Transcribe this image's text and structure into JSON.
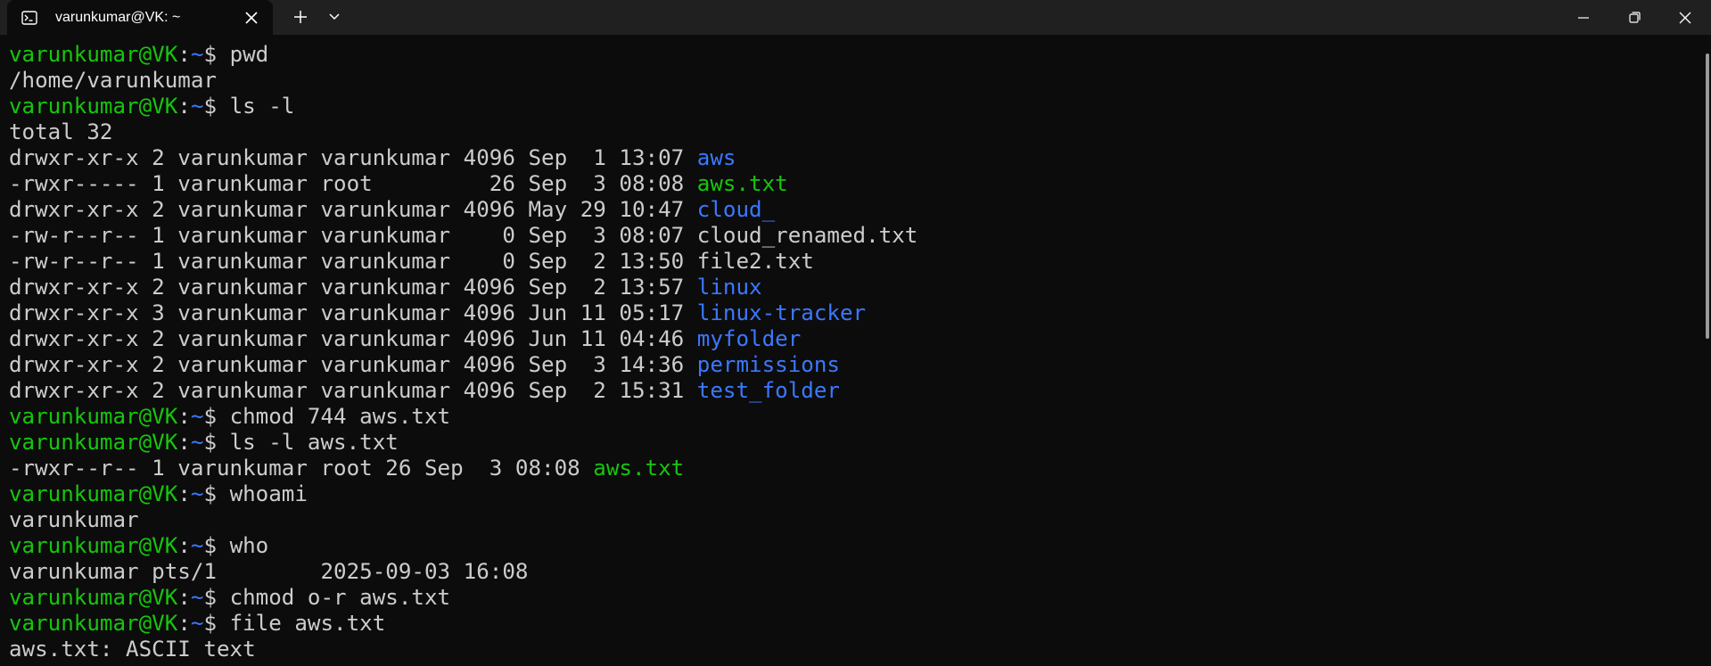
{
  "window": {
    "tab_title": "varunkumar@VK: ~",
    "icons": {
      "tab": "terminal-icon",
      "close_tab": "close-icon",
      "new_tab": "plus-icon",
      "dropdown": "chevron-down-icon",
      "minimize": "minimize-icon",
      "restore": "restore-icon",
      "close_window": "close-icon"
    }
  },
  "colors": {
    "background": "#0c0c0c",
    "titlebar": "#202020",
    "prompt_user": "#16c60c",
    "prompt_path": "#3b78ff",
    "directory": "#3b78ff",
    "executable": "#16c60c",
    "text": "#cccccc"
  },
  "terminal": {
    "prompt": {
      "user": "varunkumar@VK",
      "sep": ":",
      "path": "~",
      "symbol": "$ "
    },
    "lines": [
      {
        "kind": "cmd",
        "text": "pwd"
      },
      {
        "kind": "out",
        "text": "/home/varunkumar"
      },
      {
        "kind": "cmd",
        "text": "ls -l"
      },
      {
        "kind": "out",
        "text": "total 32"
      },
      {
        "kind": "ls",
        "meta": "drwxr-xr-x 2 varunkumar varunkumar 4096 Sep  1 13:07 ",
        "name": "aws",
        "color": "blue"
      },
      {
        "kind": "ls",
        "meta": "-rwxr----- 1 varunkumar root         26 Sep  3 08:08 ",
        "name": "aws.txt",
        "color": "green"
      },
      {
        "kind": "ls",
        "meta": "drwxr-xr-x 2 varunkumar varunkumar 4096 May 29 10:47 ",
        "name": "cloud_",
        "color": "blue"
      },
      {
        "kind": "ls",
        "meta": "-rw-r--r-- 1 varunkumar varunkumar    0 Sep  3 08:07 ",
        "name": "cloud_renamed.txt",
        "color": "white"
      },
      {
        "kind": "ls",
        "meta": "-rw-r--r-- 1 varunkumar varunkumar    0 Sep  2 13:50 ",
        "name": "file2.txt",
        "color": "white"
      },
      {
        "kind": "ls",
        "meta": "drwxr-xr-x 2 varunkumar varunkumar 4096 Sep  2 13:57 ",
        "name": "linux",
        "color": "blue"
      },
      {
        "kind": "ls",
        "meta": "drwxr-xr-x 3 varunkumar varunkumar 4096 Jun 11 05:17 ",
        "name": "linux-tracker",
        "color": "blue"
      },
      {
        "kind": "ls",
        "meta": "drwxr-xr-x 2 varunkumar varunkumar 4096 Jun 11 04:46 ",
        "name": "myfolder",
        "color": "blue"
      },
      {
        "kind": "ls",
        "meta": "drwxr-xr-x 2 varunkumar varunkumar 4096 Sep  3 14:36 ",
        "name": "permissions",
        "color": "blue"
      },
      {
        "kind": "ls",
        "meta": "drwxr-xr-x 2 varunkumar varunkumar 4096 Sep  2 15:31 ",
        "name": "test_folder",
        "color": "blue"
      },
      {
        "kind": "cmd",
        "text": "chmod 744 aws.txt"
      },
      {
        "kind": "cmd",
        "text": "ls -l aws.txt"
      },
      {
        "kind": "ls",
        "meta": "-rwxr--r-- 1 varunkumar root 26 Sep  3 08:08 ",
        "name": "aws.txt",
        "color": "green"
      },
      {
        "kind": "cmd",
        "text": "whoami"
      },
      {
        "kind": "out",
        "text": "varunkumar"
      },
      {
        "kind": "cmd",
        "text": "who"
      },
      {
        "kind": "out",
        "text": "varunkumar pts/1        2025-09-03 16:08"
      },
      {
        "kind": "cmd",
        "text": "chmod o-r aws.txt"
      },
      {
        "kind": "cmd",
        "text": "file aws.txt"
      },
      {
        "kind": "out",
        "text": "aws.txt: ASCII text"
      }
    ]
  }
}
